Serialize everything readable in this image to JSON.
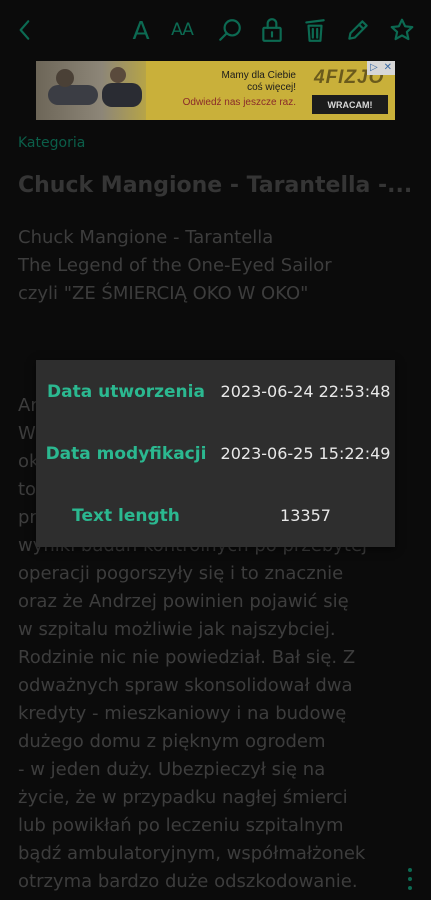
{
  "toolbar": {
    "items": [
      {
        "name": "back-icon"
      },
      {
        "name": "font-icon",
        "glyph": "A"
      },
      {
        "name": "font-size-icon",
        "glyph": "AA"
      },
      {
        "name": "search-icon"
      },
      {
        "name": "lock-icon"
      },
      {
        "name": "trash-icon"
      },
      {
        "name": "edit-icon"
      },
      {
        "name": "star-icon"
      }
    ],
    "accent_color": "#0c6a52"
  },
  "ad": {
    "line1": "Mamy dla Ciebie",
    "line2": "coś więcej!",
    "line3": "Odwiedź nas jeszcze raz.",
    "logo": "4FIZJO",
    "button": "WRACAM!"
  },
  "note": {
    "category": "Kategoria",
    "title": "Chuck Mangione - Tarantella -...",
    "intro_lines": [
      "Chuck Mangione - Tarantella",
      "The Legend of the One-Eyed Sailor",
      "czyli \"ZE ŚMIERCIĄ OKO W OKO\""
    ],
    "body_lines": [
      "Ar",
      "W",
      "ok",
      "to",
      "pr",
      "wyniki badań kontrolnych po przebytej",
      "operacji pogorszyły się i to znacznie",
      "oraz że Andrzej powinien pojawić się",
      "w szpitalu możliwie jak najszybciej.",
      "Rodzinie nic nie powiedział. Bał się. Z",
      "odważnych spraw skonsolidował dwa",
      "kredyty - mieszkaniowy i na budowę",
      "dużego domu z pięknym ogrodem",
      "- w jeden duży. Ubezpieczył się na",
      "życie, że w przypadku nagłej śmierci",
      "lub powikłań po leczeniu szpitalnym",
      "bądź ambulatoryjnym, współmałżonek",
      "otrzyma bardzo duże odszkodowanie."
    ]
  },
  "info_dialog": {
    "rows": [
      {
        "label": "Data utworzenia",
        "value": "2023-06-24 22:53:48"
      },
      {
        "label": "Data modyfikacji",
        "value": "2023-06-25 15:22:49"
      },
      {
        "label": "Text length",
        "value": "13357"
      }
    ],
    "label_color": "#2bb890"
  },
  "more_menu": {
    "icon": "more-vert-icon"
  }
}
